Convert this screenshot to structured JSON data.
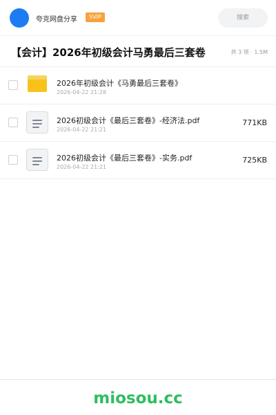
{
  "header": {
    "brand": "夸克网盘分享",
    "badge": "SVIP",
    "search_placeholder": "搜索",
    "avatar_color": "#1e7cf2",
    "badge_color": "#f7a23b"
  },
  "share": {
    "title": "【会计】2026年初级会计马勇最后三套卷",
    "meta": "共 3 项 · 1.5M"
  },
  "files": [
    {
      "type": "folder-icon",
      "name": "2026年初级会计《马勇最后三套卷》",
      "date": "2026-04-22 21:28",
      "size": ""
    },
    {
      "type": "document-icon",
      "name": "2026初级会计《最后三套卷》-经济法.pdf",
      "date": "2026-04-22 21:21",
      "size": "771KB"
    },
    {
      "type": "document-icon",
      "name": "2026初级会计《最后三套卷》-实务.pdf",
      "date": "2026-04-22 21:21",
      "size": "725KB"
    }
  ],
  "footer": {
    "watermark": "miosou.cc",
    "watermark_color": "#2dbe5f"
  }
}
